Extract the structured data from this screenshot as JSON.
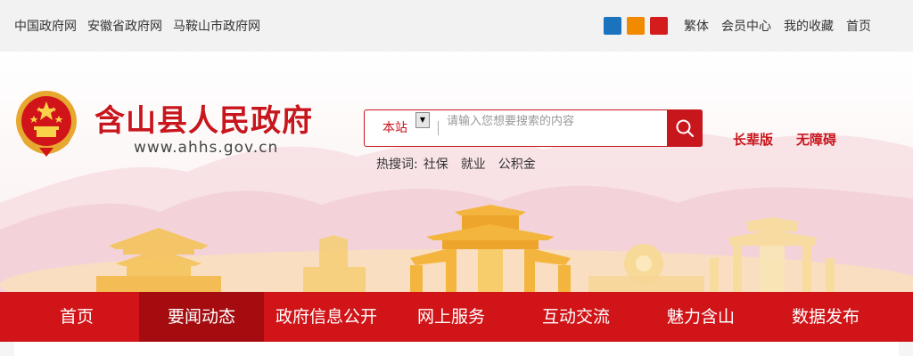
{
  "topbar": {
    "links": [
      "中国政府网",
      "安徽省政府网",
      "马鞍山市政府网"
    ],
    "share_icons": [
      {
        "name": "weibo-share-icon",
        "color": "#1b73bd"
      },
      {
        "name": "rss-share-icon",
        "color": "#f28a00"
      },
      {
        "name": "wechat-share-icon",
        "color": "#d41c1c"
      }
    ],
    "right_links": [
      "繁体",
      "会员中心",
      "我的收藏",
      "首页"
    ]
  },
  "header": {
    "title": "含山县人民政府",
    "url": "www.ahhs.gov.cn",
    "search": {
      "scope": "本站",
      "placeholder": "请输入您想要搜索的内容"
    },
    "hot_label": "热搜词:",
    "hot_words": [
      "社保",
      "就业",
      "公积金"
    ],
    "accessibility": [
      "长辈版",
      "无障碍"
    ]
  },
  "nav": {
    "items": [
      "首页",
      "要闻动态",
      "政府信息公开",
      "网上服务",
      "互动交流",
      "魅力含山",
      "数据发布"
    ],
    "active": "要闻动态"
  },
  "colors": {
    "primary_red": "#d01418",
    "active_red": "#a40c10",
    "title_red": "#c8161d",
    "topbar_bg": "#f2f2f2"
  }
}
